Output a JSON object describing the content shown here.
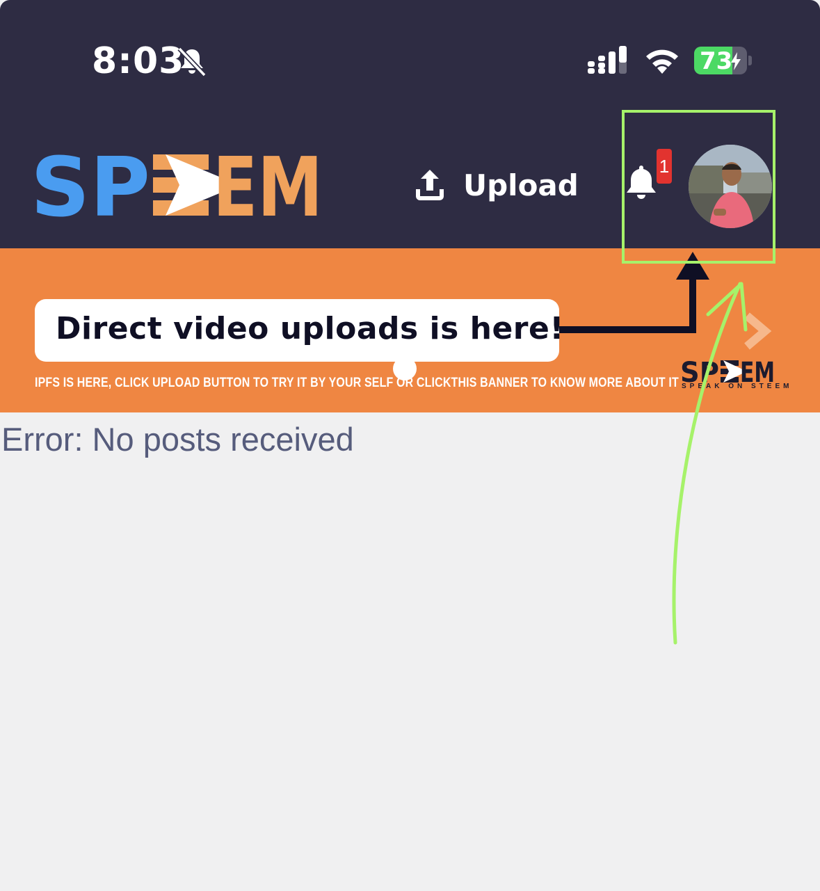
{
  "status_bar": {
    "time": "8:03",
    "battery_level": "73",
    "icons": [
      "bell-slash-icon",
      "cellular-signal-icon",
      "wifi-icon",
      "battery-charging-icon"
    ]
  },
  "header": {
    "logo_text": "SPEEM",
    "upload_label": "Upload",
    "notification_count": "1"
  },
  "banner": {
    "headline": "Direct video uploads is here!",
    "subtext": "IPFS IS HERE, CLICK UPLOAD BUTTON TO TRY IT BY YOUR SELF OR  CLICKTHIS BANNER TO KNOW MORE ABOUT IT",
    "logo_text": "SPEEM",
    "logo_tagline": "SPEAK ON STEEM"
  },
  "content": {
    "error_message": "Error: No posts received"
  },
  "colors": {
    "header_bg": "#2e2c43",
    "banner_bg": "#ef8642",
    "logo_blue": "#4a9cf0",
    "logo_orange": "#f0a25c",
    "annotation_green": "#a6f26a",
    "badge_red": "#e2332f",
    "page_bg": "#f0f0f1"
  }
}
